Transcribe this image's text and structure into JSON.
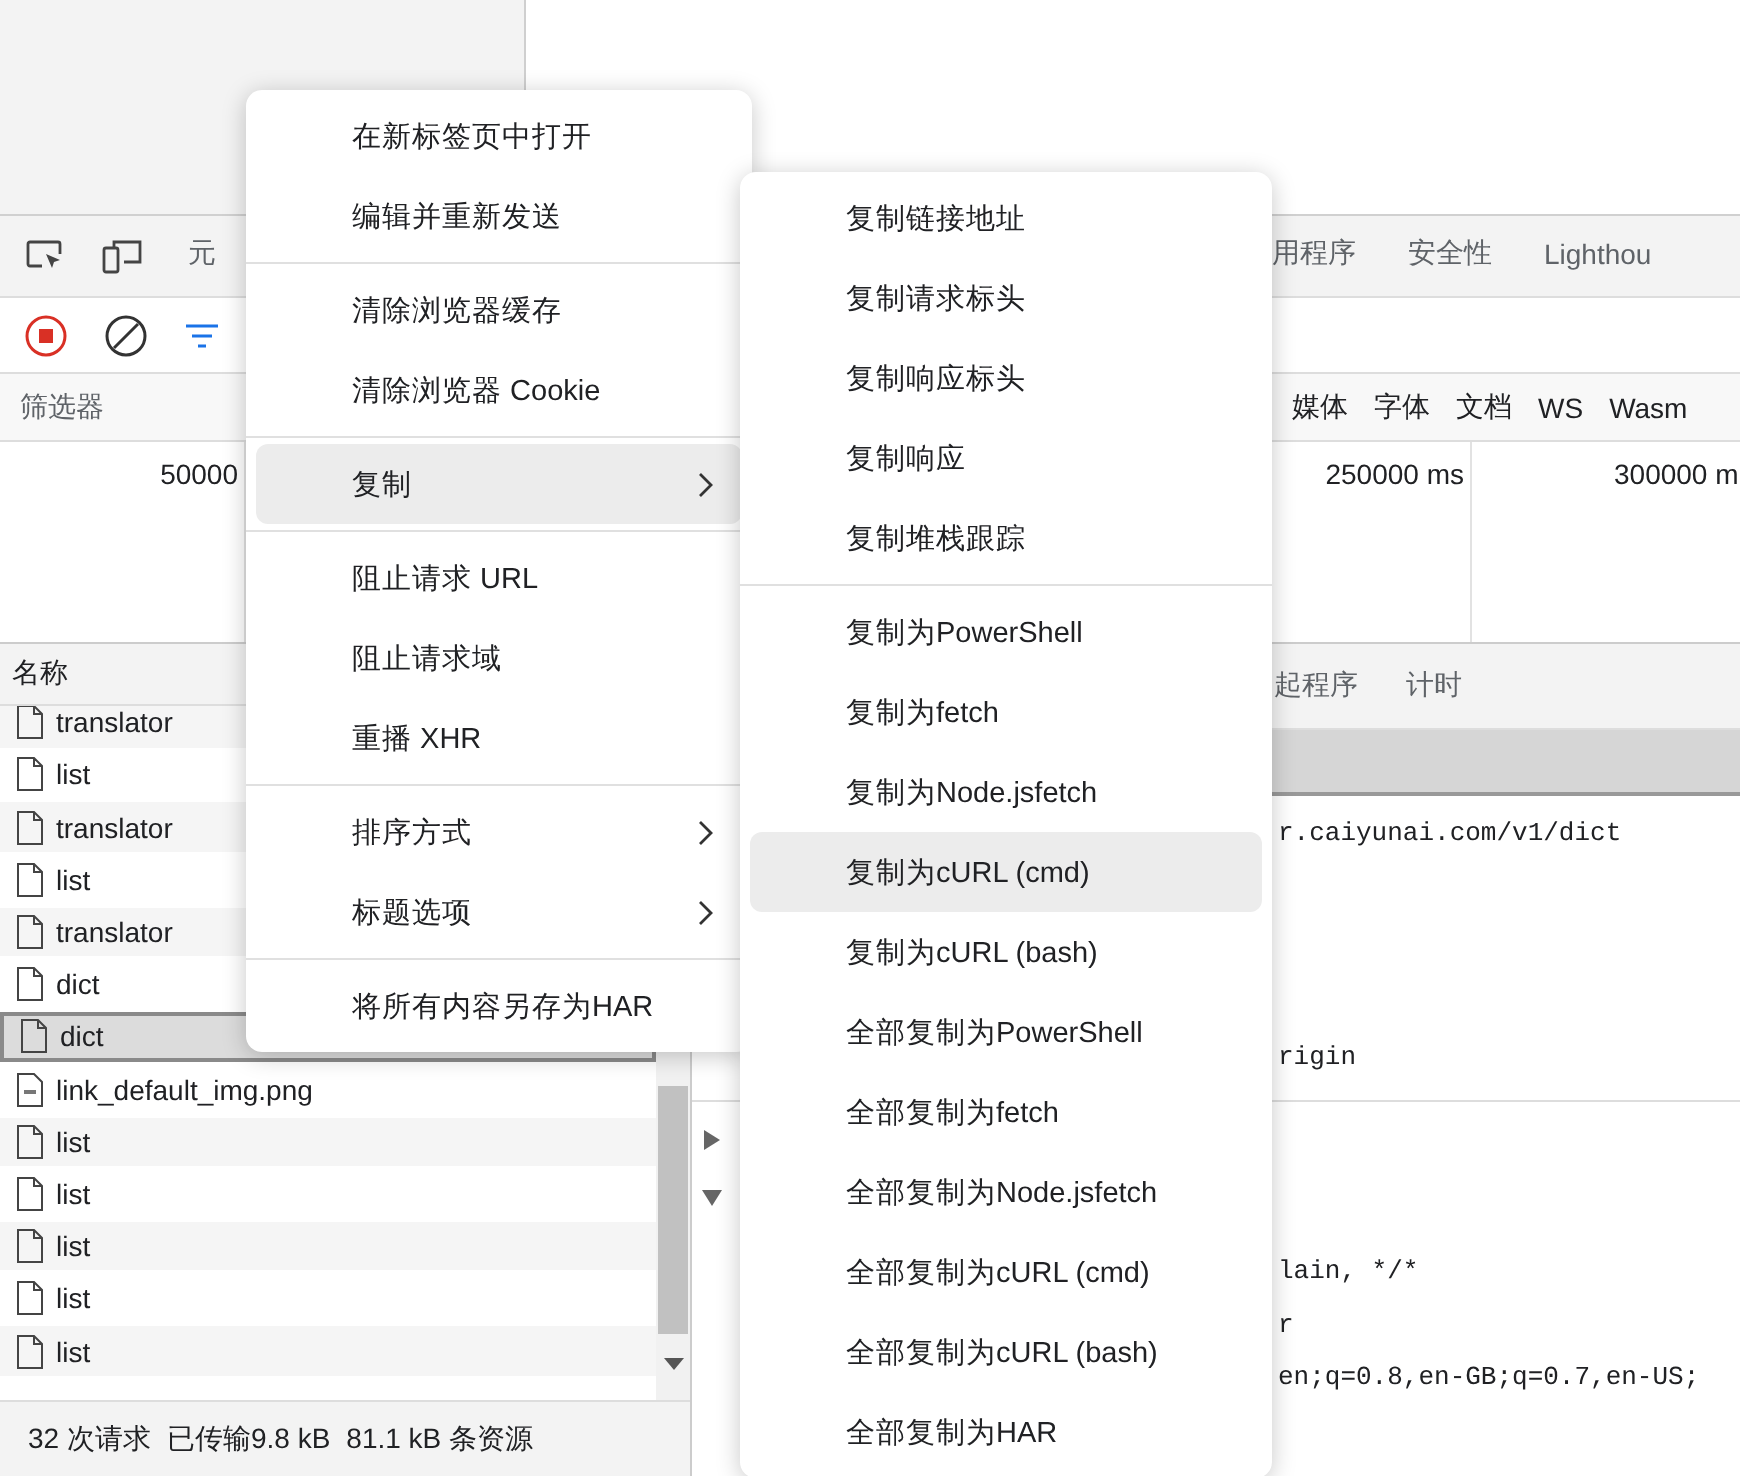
{
  "tabs": [
    {
      "label": "元",
      "selected": false
    },
    {
      "label": "用程序",
      "selected": false
    },
    {
      "label": "安全性",
      "selected": false
    },
    {
      "label": "Lighthou",
      "selected": false
    }
  ],
  "filter": {
    "label": "筛选器",
    "types": [
      "媒体",
      "字体",
      "文档",
      "WS",
      "Wasm"
    ]
  },
  "overview": {
    "ticks": [
      "50000",
      "250000 ms",
      "300000 m"
    ]
  },
  "requests": {
    "header": "名称",
    "rows": [
      {
        "name": "translator",
        "kind": "doc",
        "selected": false
      },
      {
        "name": "list",
        "kind": "doc",
        "selected": false
      },
      {
        "name": "translator",
        "kind": "doc",
        "selected": false
      },
      {
        "name": "list",
        "kind": "doc",
        "selected": false
      },
      {
        "name": "translator",
        "kind": "doc",
        "selected": false
      },
      {
        "name": "dict",
        "kind": "doc",
        "selected": false
      },
      {
        "name": "dict",
        "kind": "doc",
        "selected": true
      },
      {
        "name": "link_default_img.png",
        "kind": "image",
        "selected": false
      },
      {
        "name": "list",
        "kind": "doc",
        "selected": false
      },
      {
        "name": "list",
        "kind": "doc",
        "selected": false
      },
      {
        "name": "list",
        "kind": "doc",
        "selected": false
      },
      {
        "name": "list",
        "kind": "doc",
        "selected": false
      },
      {
        "name": "list",
        "kind": "doc",
        "selected": false
      }
    ]
  },
  "details": {
    "tabs": [
      "起程序",
      "计时"
    ],
    "general_lines": [
      "r.caiyunai.com/v1/dict",
      "rigin"
    ],
    "header_lines": [
      "lain, */*",
      "r",
      "en;q=0.8,en-GB;q=0.7,en-US;"
    ]
  },
  "status_bar": [
    "32 次请求",
    "已传输9.8 kB",
    "81.1 kB 条资源"
  ],
  "context_menu": {
    "groups": [
      {
        "items": [
          {
            "label": "在新标签页中打开",
            "submenu": false,
            "highlighted": false
          },
          {
            "label": "编辑并重新发送",
            "submenu": false,
            "highlighted": false
          }
        ]
      },
      {
        "items": [
          {
            "label": "清除浏览器缓存",
            "submenu": false,
            "highlighted": false
          },
          {
            "label": "清除浏览器 Cookie",
            "submenu": false,
            "highlighted": false
          }
        ]
      },
      {
        "items": [
          {
            "label": "复制",
            "submenu": true,
            "highlighted": true
          }
        ]
      },
      {
        "items": [
          {
            "label": "阻止请求 URL",
            "submenu": false,
            "highlighted": false
          },
          {
            "label": "阻止请求域",
            "submenu": false,
            "highlighted": false
          },
          {
            "label": "重播 XHR",
            "submenu": false,
            "highlighted": false
          }
        ]
      },
      {
        "items": [
          {
            "label": "排序方式",
            "submenu": true,
            "highlighted": false
          },
          {
            "label": "标题选项",
            "submenu": true,
            "highlighted": false
          }
        ]
      },
      {
        "items": [
          {
            "label": "将所有内容另存为HAR",
            "submenu": false,
            "highlighted": false
          }
        ]
      }
    ]
  },
  "copy_submenu": {
    "groups": [
      {
        "items": [
          {
            "label": "复制链接地址",
            "highlighted": false
          },
          {
            "label": "复制请求标头",
            "highlighted": false
          },
          {
            "label": "复制响应标头",
            "highlighted": false
          },
          {
            "label": "复制响应",
            "highlighted": false
          },
          {
            "label": "复制堆栈跟踪",
            "highlighted": false
          }
        ]
      },
      {
        "items": [
          {
            "label": "复制为PowerShell",
            "highlighted": false
          },
          {
            "label": "复制为fetch",
            "highlighted": false
          },
          {
            "label": "复制为Node.jsfetch",
            "highlighted": false
          },
          {
            "label": "复制为cURL (cmd)",
            "highlighted": true
          },
          {
            "label": "复制为cURL (bash)",
            "highlighted": false
          },
          {
            "label": "全部复制为PowerShell",
            "highlighted": false
          },
          {
            "label": "全部复制为fetch",
            "highlighted": false
          },
          {
            "label": "全部复制为Node.jsfetch",
            "highlighted": false
          },
          {
            "label": "全部复制为cURL (cmd)",
            "highlighted": false
          },
          {
            "label": "全部复制为cURL (bash)",
            "highlighted": false
          },
          {
            "label": "全部复制为HAR",
            "highlighted": false
          }
        ]
      }
    ]
  }
}
